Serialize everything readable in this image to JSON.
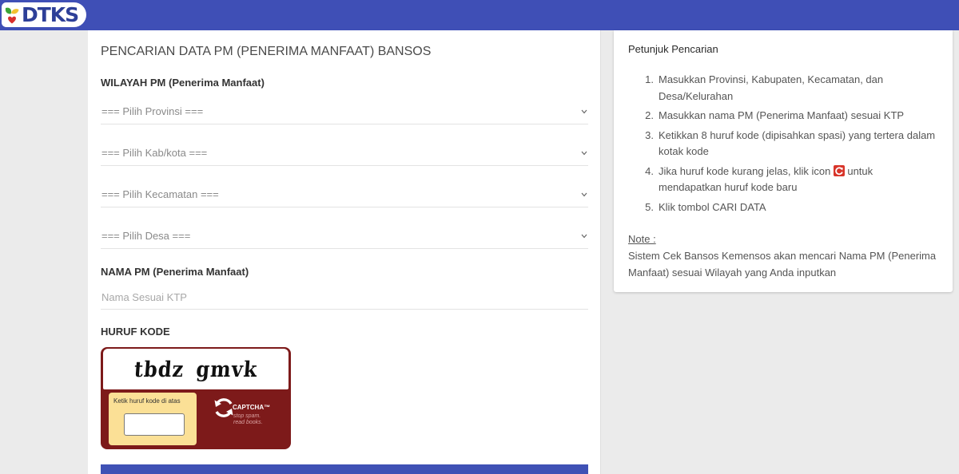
{
  "header": {
    "logo_text": "DTKS"
  },
  "colors": {
    "page_bg": "#ebebeb",
    "header_bg": "#3f4fb6",
    "button_bg": "#3f51b5",
    "captcha_red": "#7d1a1a",
    "captcha_yellow": "#fbe096",
    "refresh_icon_red": "#d8352a"
  },
  "icons": {
    "logo": "dtks-leaf-heart-icon",
    "select_chevron": "chevron-down-icon",
    "captcha_refresh": "captcha-refresh-arrows-icon",
    "instruction_refresh": "refresh-icon"
  },
  "form": {
    "title": "PENCARIAN DATA PM (PENERIMA MANFAAT) BANSOS",
    "wilayah_label": "WILAYAH PM (Penerima Manfaat)",
    "selects": [
      {
        "selected": "=== Pilih Provinsi ==="
      },
      {
        "selected": "=== Pilih Kab/kota ==="
      },
      {
        "selected": "=== Pilih Kecamatan ==="
      },
      {
        "selected": "=== Pilih Desa ==="
      }
    ],
    "nama_label": "NAMA PM (Penerima Manfaat)",
    "nama_input": {
      "placeholder": "Nama Sesuai KTP",
      "value": ""
    },
    "kode_label": "HURUF KODE",
    "captcha": {
      "challenge": "tbdz gmvk",
      "prompt": "Ketik huruf kode di atas",
      "response_value": "",
      "brand": "CAPTCHA™",
      "tagline_1": "stop spam.",
      "tagline_2": "read books."
    }
  },
  "help": {
    "title": "Petunjuk Pencarian",
    "steps": [
      {
        "num": "1.",
        "lines": [
          "Masukkan Provinsi, Kabupaten, Kecamatan, dan",
          "Desa/Kelurahan"
        ]
      },
      {
        "num": "2.",
        "lines": [
          "Masukkan nama PM (Penerima Manfaat) sesuai KTP"
        ]
      },
      {
        "num": "3.",
        "lines": [
          "Ketikkan 8 huruf kode (dipisahkan spasi) yang tertera dalam",
          "kotak kode"
        ]
      },
      {
        "num": "4.",
        "before_icon": "Jika huruf kode kurang jelas, klik icon",
        "after_icon": "untuk",
        "line_2": "mendapatkan huruf kode baru"
      },
      {
        "num": "5.",
        "lines": [
          "Klik tombol CARI DATA"
        ]
      }
    ],
    "note_label": "Note :",
    "note_lines": [
      "Sistem Cek Bansos Kemensos akan mencari Nama PM (Penerima",
      "Manfaat) sesuai Wilayah yang Anda inputkan"
    ]
  }
}
